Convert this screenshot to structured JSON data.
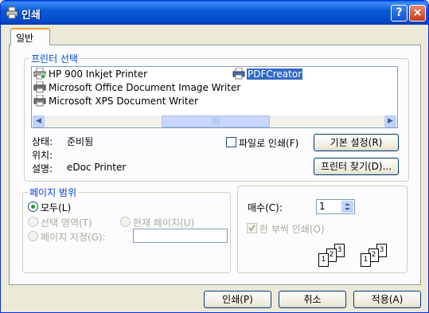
{
  "window": {
    "title": "인쇄",
    "help_label": "?",
    "close_label": "×"
  },
  "tabs": [
    {
      "label": "일반"
    }
  ],
  "printer_group": {
    "legend": "프린터 선택",
    "printers": [
      {
        "name": "HP 900 Inkjet Printer",
        "selected": false
      },
      {
        "name": "Microsoft Office Document Image Writer",
        "selected": false
      },
      {
        "name": "Microsoft XPS Document Writer",
        "selected": false
      },
      {
        "name": "PDFCreator",
        "selected": true
      }
    ],
    "scroll_left": "◀",
    "scroll_right": "▶",
    "scroll_grip": "|||"
  },
  "status": {
    "label": "상태:",
    "value": "준비됨"
  },
  "location": {
    "label": "위치:",
    "value": ""
  },
  "comment": {
    "label": "설명:",
    "value": "eDoc Printer"
  },
  "print_to_file": {
    "label": "파일로 인쇄(F)",
    "checked": false
  },
  "buttons": {
    "preferences": "기본 설정(R)",
    "find_printer": "프린터 찾기(D)...",
    "print": "인쇄(P)",
    "cancel": "취소",
    "apply": "적용(A)"
  },
  "page_range": {
    "legend": "페이지 범위",
    "all": "모두(L)",
    "selection": "선택 영역(T)",
    "current_page": "현재 페이지(U)",
    "pages": "페이지 지정(G):",
    "pages_value": ""
  },
  "copies": {
    "label": "매수(C):",
    "value": "1",
    "collate_label": "한 부씩 인쇄(O)",
    "collate_checked": true,
    "page_numbers": [
      "1",
      "2",
      "3",
      "1",
      "2",
      "3"
    ]
  }
}
